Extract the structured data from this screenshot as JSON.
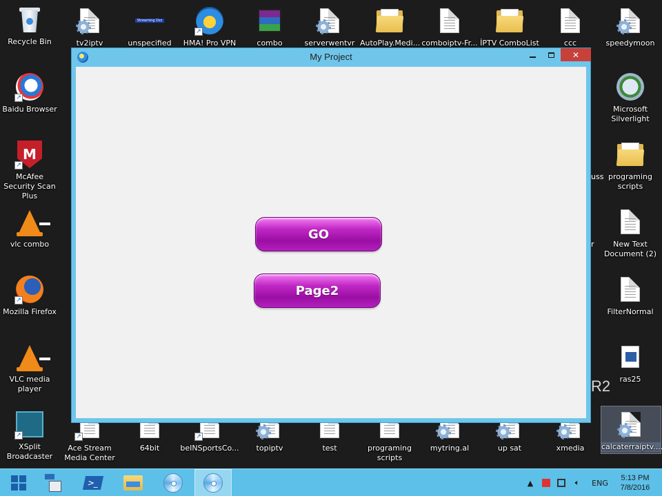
{
  "desktop": {
    "left_column": [
      {
        "label": "Recycle Bin",
        "icon": "recycle-bin-icon"
      },
      {
        "label": "Baidu Browser",
        "icon": "baidu-browser-icon"
      },
      {
        "label": "McAfee Security Scan Plus",
        "icon": "mcafee-icon"
      },
      {
        "label": "vlc combo",
        "icon": "vlc-icon"
      },
      {
        "label": "Mozilla Firefox",
        "icon": "firefox-icon"
      },
      {
        "label": "VLC media player",
        "icon": "vlc-icon"
      },
      {
        "label": "XSplit Broadcaster",
        "icon": "xsplit-icon"
      }
    ],
    "top_row": [
      {
        "label": "tv2iptv",
        "icon": "settings-file-icon"
      },
      {
        "label": "unspecified",
        "icon": "image-file-icon",
        "ribbon": "Streaming Dzz"
      },
      {
        "label": "HMA! Pro VPN",
        "icon": "hma-vpn-icon"
      },
      {
        "label": "combo",
        "icon": "winrar-icon"
      },
      {
        "label": "serverwentvr",
        "icon": "settings-file-icon"
      },
      {
        "label": "AutoPlay.Medi...",
        "icon": "folder-icon"
      },
      {
        "label": "comboiptv-Fr...",
        "icon": "text-file-icon"
      },
      {
        "label": "İPTV ComboList",
        "icon": "folder-icon"
      },
      {
        "label": "ccc",
        "icon": "text-file-icon"
      },
      {
        "label": "speedymoon",
        "icon": "settings-file-icon"
      }
    ],
    "right_column": [
      {
        "label": "Microsoft Silverlight",
        "icon": "silverlight-icon"
      },
      {
        "label": "programing scripts",
        "icon": "folder-icon"
      },
      {
        "label": "New Text Document (2)",
        "icon": "text-file-icon"
      },
      {
        "label": "FilterNormal",
        "icon": "text-file-icon"
      },
      {
        "label": "ras25",
        "icon": "video-file-icon"
      },
      {
        "label": "calcaterraiptv....",
        "icon": "settings-file-icon",
        "selected": true
      }
    ],
    "bottom_row": [
      {
        "label": "Ace Stream Media Center",
        "icon": "ace-stream-icon"
      },
      {
        "label": "64bit",
        "icon": "settings-file-icon"
      },
      {
        "label": "beINSportsCo...",
        "icon": "settings-file-icon"
      },
      {
        "label": "topiptv",
        "icon": "settings-file-icon"
      },
      {
        "label": "test",
        "icon": "text-file-icon"
      },
      {
        "label": "programing scripts",
        "icon": "settings-file-icon"
      },
      {
        "label": "mytring.al",
        "icon": "settings-file-icon"
      },
      {
        "label": "up sat",
        "icon": "settings-file-icon"
      },
      {
        "label": "xmedia",
        "icon": "settings-file-icon"
      }
    ],
    "partial_texts": {
      "uss": "uss",
      "r": "r",
      "r2": "R2"
    }
  },
  "window": {
    "title": "My Project",
    "buttons": {
      "go": "GO",
      "page2": "Page2"
    }
  },
  "taskbar": {
    "language": "ENG",
    "time": "5:13 PM",
    "date": "7/8/2016"
  },
  "colors": {
    "window_border": "#6fc6ea",
    "taskbar": "#5dc0e8",
    "button_purple": "#c027c4",
    "close_red": "#c7413a"
  }
}
